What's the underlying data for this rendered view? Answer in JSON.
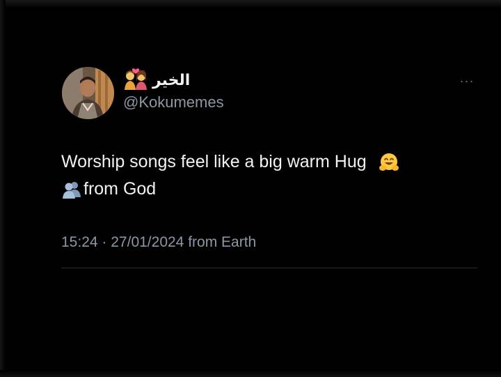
{
  "tweet": {
    "display_name": "الخير",
    "name_emoji": "couple-with-heart-icon",
    "handle": "@Kokumemes",
    "more_label": "···",
    "text_line1": "Worship songs feel like a big warm Hug",
    "text_line1_emoji": "hugging-face-icon",
    "text_line2_emoji": "busts-in-silhouette-icon",
    "text_line2": "from God",
    "time": "15:24",
    "separator": "·",
    "date": "27/01/2024",
    "source": "from Earth"
  },
  "colors": {
    "background": "#000000",
    "text_primary": "#f2f2f2",
    "text_secondary": "#8b98a5",
    "divider": "#2a2d30"
  }
}
